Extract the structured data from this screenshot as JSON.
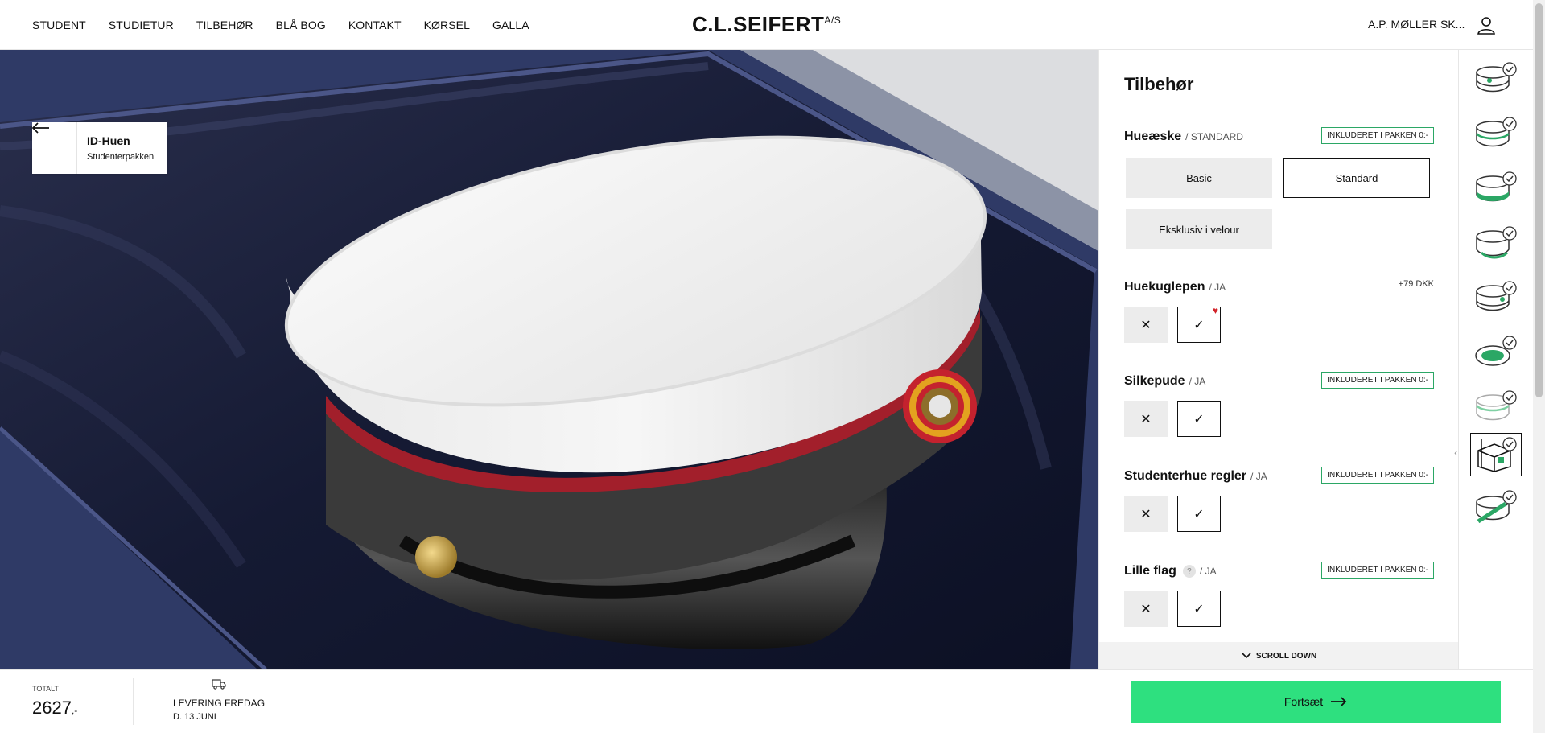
{
  "nav": {
    "links": [
      "STUDENT",
      "STUDIETUR",
      "TILBEHØR",
      "BLÅ BOG",
      "KONTAKT",
      "KØRSEL",
      "GALLA"
    ],
    "logo": "C.L.SEIFERT",
    "logo_sup": "A/S",
    "account": "A.P. MØLLER SK..."
  },
  "back": {
    "title": "ID-Huen",
    "subtitle": "Studenterpakken"
  },
  "panel": {
    "title": "Tilbehør",
    "hueaeske": {
      "name": "Hueæske",
      "sub": "/ STANDARD",
      "badge": "INKLUDERET I PAKKEN 0:-",
      "options": [
        "Basic",
        "Standard",
        "Eksklusiv i velour"
      ],
      "selected": "Standard"
    },
    "huekuglepen": {
      "name": "Huekuglepen",
      "sub": "/ JA",
      "price": "+79 DKK"
    },
    "silkepude": {
      "name": "Silkepude",
      "sub": "/ JA",
      "badge": "INKLUDERET I PAKKEN 0:-"
    },
    "regler": {
      "name": "Studenterhue regler",
      "sub": "/ JA",
      "badge": "INKLUDERET I PAKKEN 0:-"
    },
    "flag": {
      "name": "Lille flag",
      "help": "?",
      "sub": "/ JA",
      "badge": "INKLUDERET I PAKKEN 0:-"
    },
    "scroll_down": "SCROLL DOWN"
  },
  "footer": {
    "total_label": "TOTALT",
    "total_value": "2627",
    "total_suffix": ",-",
    "delivery_line1": "LEVERING FREDAG",
    "delivery_line2": "D. 13 JUNI",
    "cta_label": "Fortsæt"
  },
  "colors": {
    "accent_green": "#2ee07f",
    "badge_green": "#2ba765",
    "box_blue": "#2f3a66"
  },
  "icons": [
    "back-arrow-icon",
    "user-icon",
    "close-icon",
    "check-icon",
    "heart-icon",
    "truck-icon",
    "chevron-down-icon",
    "arrow-right-icon"
  ]
}
